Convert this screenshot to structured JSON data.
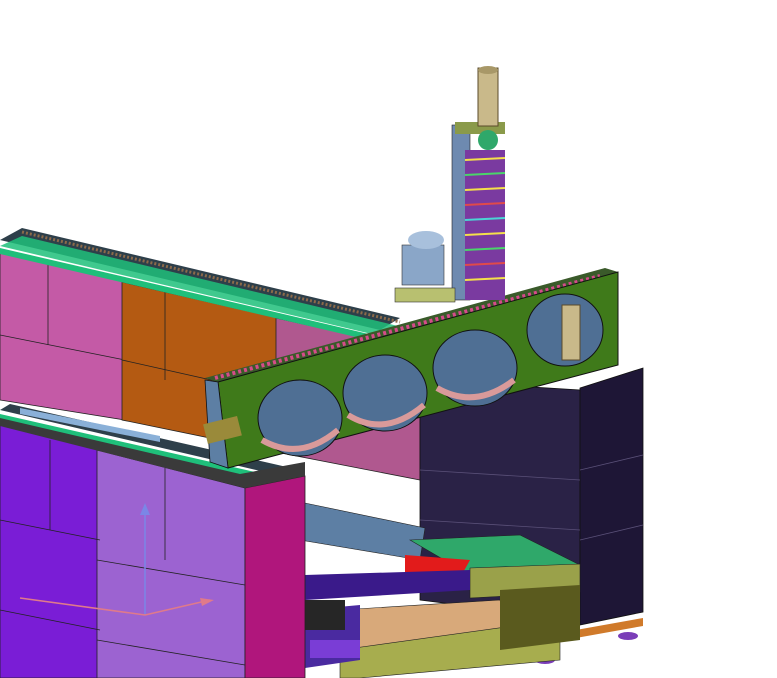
{
  "viewport": {
    "background": "#ffffff",
    "model": "gantry-machine-assembly"
  },
  "colors": {
    "pink_panel": "#c45aa6",
    "pink_panel_dark": "#a7468d",
    "orange_panel": "#b45a12",
    "purple_panel": "#7a1dd6",
    "lilac_panel": "#9c63d1",
    "magenta_panel": "#b0167c",
    "green_beam": "#3f7a1a",
    "green_rail": "#1fbf7a",
    "dark_panel": "#2a2246",
    "dark_panel_side": "#1e1636",
    "steel_blue": "#5d7fa4",
    "salmon": "#d99a9a",
    "khaki": "#9aa14a",
    "tan": "#d8a97a",
    "red": "#e21b1b",
    "motor_blue": "#8aa6c8",
    "cylinder_tan": "#c9b98a",
    "axis_blue": "#7b86e6",
    "axis_red": "#e07a8a"
  }
}
